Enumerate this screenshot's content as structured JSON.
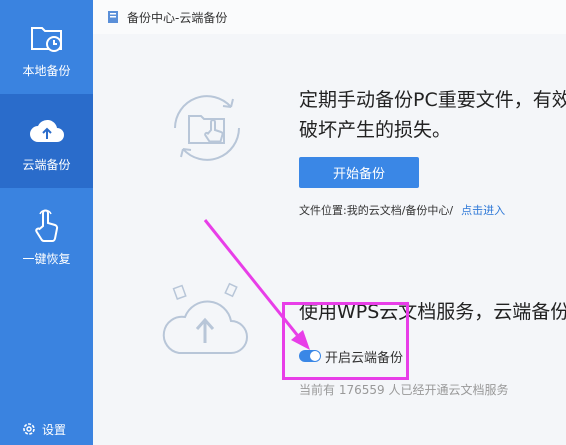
{
  "sidebar": {
    "items": [
      {
        "label": "本地备份",
        "icon": "folder-clock-icon",
        "active": false
      },
      {
        "label": "云端备份",
        "icon": "cloud-upload-icon",
        "active": true
      },
      {
        "label": "一键恢复",
        "icon": "hand-pointer-icon",
        "active": false
      }
    ],
    "settings_label": "设置"
  },
  "titlebar": {
    "title": "备份中心-云端备份"
  },
  "backup_section": {
    "heading_line1": "定期手动备份PC重要文件，有效",
    "heading_line2": "破坏产生的损失。",
    "start_button": "开始备份",
    "file_location_label": "文件位置:我的云文档/备份中心/",
    "file_location_link": "点击进入"
  },
  "cloud_section": {
    "heading": "使用WPS云文档服务，云端备份",
    "toggle_label": "开启云端备份",
    "toggle_on": true,
    "user_count_text": "当前有 176559 人已经开通云文档服务"
  },
  "colors": {
    "sidebar": "#3a83e0",
    "sidebar_active": "#2a6ccb",
    "accent": "#3a87e6",
    "annotation": "#e83ee8"
  }
}
